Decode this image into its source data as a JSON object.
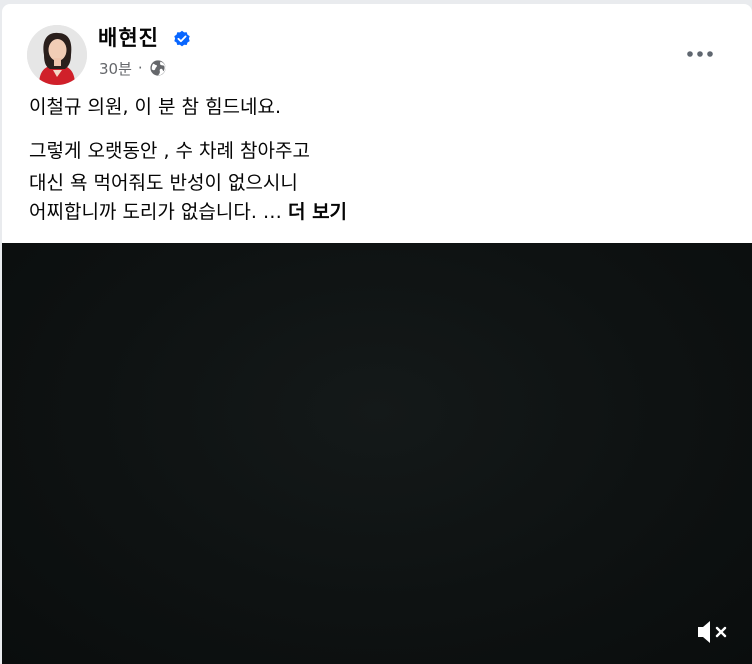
{
  "post": {
    "author": "배현진",
    "verified": true,
    "time": "30분",
    "separator": "·",
    "privacy_icon": "globe-icon",
    "more_icon": "more-options-icon",
    "text_lines": [
      "이철규 의원, 이 분 참 힘드네요.",
      "그렇게 오랫동안 , 수 차례 참아주고",
      "대신 욕 먹어줘도 반성이 없으시니",
      "어찌합니까 도리가 없습니다. … "
    ],
    "see_more": "더 보기",
    "video": {
      "mute_icon": "volume-muted-icon"
    }
  },
  "colors": {
    "text": "#050505",
    "secondary_text": "#65676b",
    "verified_blue": "#0866ff",
    "video_bg": "#0e1212"
  }
}
